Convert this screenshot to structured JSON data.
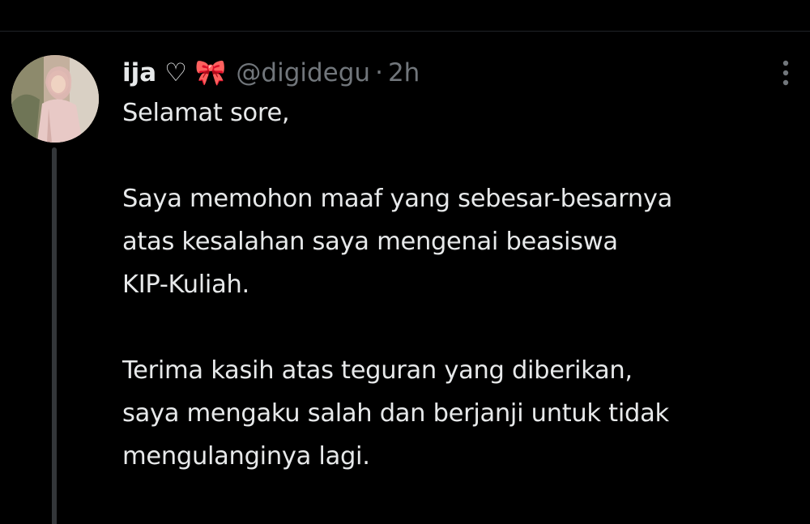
{
  "tweet": {
    "author": {
      "display_name": "ija",
      "name_emojis": "♡ 🎀",
      "handle": "@digidegu",
      "avatar_icon": "user-avatar-photo"
    },
    "separator": "·",
    "time": "2h",
    "more_icon": "vertical-ellipsis-icon",
    "body": [
      [
        "Selamat sore,"
      ],
      [
        "Saya memohon maaf yang sebesar-besarnya",
        "atas kesalahan saya mengenai beasiswa",
        "KIP-Kuliah."
      ],
      [
        "Terima kasih atas teguran yang diberikan,",
        "saya mengaku salah dan berjanji untuk tidak",
        "mengulanginya lagi."
      ]
    ]
  },
  "colors": {
    "background": "#000000",
    "primary_text": "#e7e9ea",
    "secondary_text": "#71767b",
    "thread_line": "#333639"
  }
}
